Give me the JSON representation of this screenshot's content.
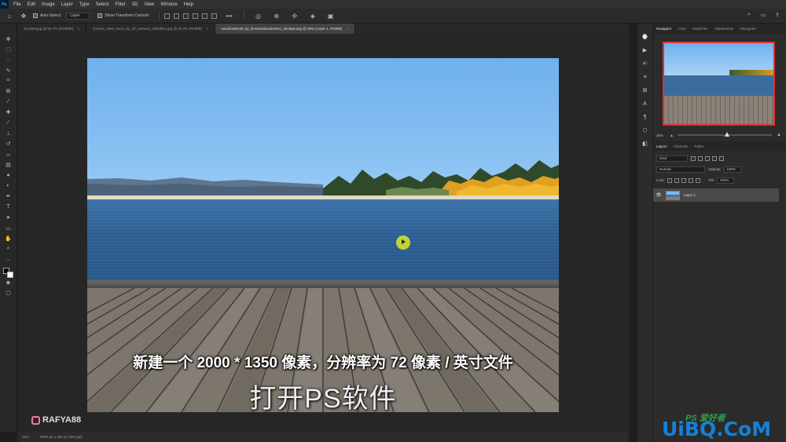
{
  "app": {
    "logo_text": "Ps"
  },
  "menu": [
    "File",
    "Edit",
    "Image",
    "Layer",
    "Type",
    "Select",
    "Filter",
    "3D",
    "View",
    "Window",
    "Help"
  ],
  "options": {
    "auto_select_label": "Auto-Select:",
    "auto_select_value": "Layer",
    "transform_label": "Show Transform Controls"
  },
  "tabs": [
    {
      "label": "Goode8.jpg @ 66.7% (RGB/8#)",
      "active": false
    },
    {
      "label": "chrome_steel_stock_by_sfr_textures_d2halbzo.jpg @ 33.3% (RGB/8)",
      "active": false
    },
    {
      "label": "woodmetex48_by_illuminatitoxdreamz_da19pk.png @ 25% (Layer 1, RGB/8)",
      "active": true
    }
  ],
  "subtitle": "新建一个 2000 * 1350 像素，分辨率为 72 像素 / 英寸文件",
  "caption": "打开PS软件",
  "brand": "RAFYA88",
  "status": {
    "zoom": "25%",
    "doc_size": "800K px x 390 px (300 ppi)"
  },
  "panels": {
    "top_tabs": [
      "Navigator",
      "Color",
      "Swatches",
      "Adjustments",
      "Histogram"
    ],
    "zoom_value": "25%",
    "layer_tabs": [
      "Layers",
      "Channels",
      "Paths"
    ],
    "kind_label": "Kind",
    "blend_mode": "Normal",
    "opacity_label": "Opacity:",
    "opacity_value": "100%",
    "lock_label": "Lock:",
    "fill_label": "Fill:",
    "fill_value": "100%",
    "layer_name": "Layer 1"
  },
  "watermark": {
    "small": "PS 爱好者",
    "main": "UiBQ.CoM"
  }
}
